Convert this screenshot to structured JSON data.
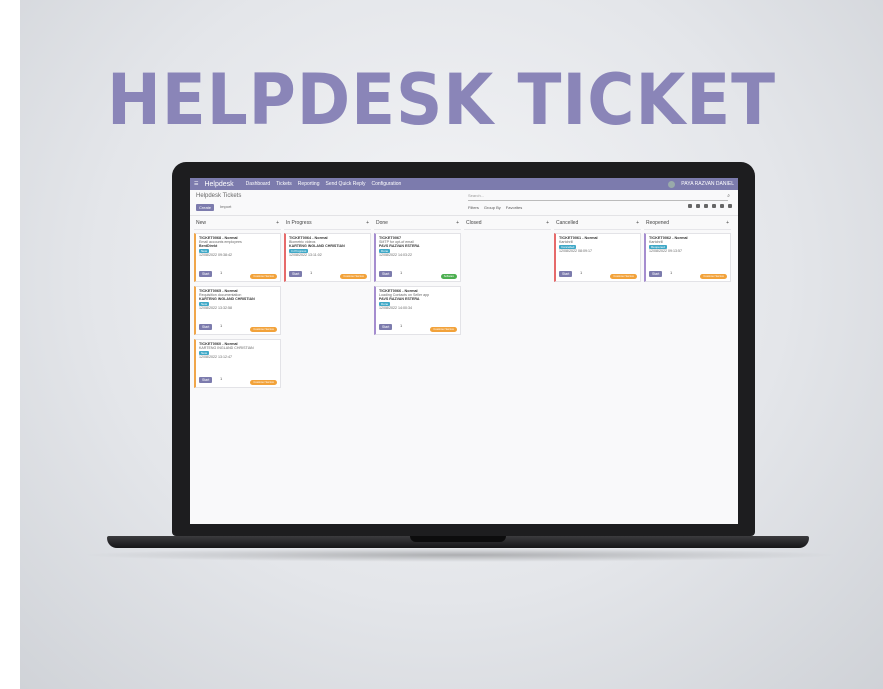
{
  "hero": {
    "title": "HELPDESK TICKET"
  },
  "app": {
    "brand": "Helpdesk",
    "menu": [
      "Dashboard",
      "Tickets",
      "Reporting",
      "Send Quick Reply",
      "Configuration"
    ],
    "user": "PAYA RAZVAN DANIEL"
  },
  "control_panel": {
    "title": "Helpdesk Tickets",
    "create_label": "Create",
    "import_label": "Import",
    "search_placeholder": "Search...",
    "filters_label": "Filters",
    "group_by_label": "Group By",
    "favorites_label": "Favorites"
  },
  "columns": [
    {
      "name": "New",
      "add": "+",
      "cards": [
        {
          "title": "TICKET0068 - Normal",
          "line1": "Email accounts employees",
          "line2": "BentDirekt",
          "tag": "New",
          "date": "12/08/2022 09:38:42",
          "start": "Start",
          "user": "1",
          "pill": "Customer Service",
          "variant": "orange"
        },
        {
          "title": "TICKET0065 - Normal",
          "line1": "Requisition documentation",
          "line2": "KARTENG INGLAND CHRISTIAN",
          "tag": "New",
          "date": "12/08/2022 13:32:58",
          "start": "Start",
          "user": "1",
          "pill": "Customer Service",
          "variant": "orange"
        },
        {
          "title": "TICKET0060 - Normal",
          "line1": "KARTENG INGLAND CHRISTIAN",
          "line2": "",
          "tag": "New",
          "date": "12/08/2022 13:12:47",
          "start": "Start",
          "user": "1",
          "pill": "Customer Service",
          "variant": "orange"
        }
      ]
    },
    {
      "name": "In Progress",
      "add": "+",
      "cards": [
        {
          "title": "TICKET0064 - Normal",
          "line1": "Biometric videos",
          "line2": "KARTENG INGLAND CHRISTIAN",
          "tag": "In Progress",
          "date": "12/08/2022 13:11:02",
          "start": "Start",
          "user": "1",
          "pill": "Customer Service",
          "variant": "red"
        }
      ]
    },
    {
      "name": "Done",
      "add": "+",
      "cards": [
        {
          "title": "TICKET0067",
          "line1": "SMTP for opt-of email",
          "line2": "PAVS RAZVAN ESTERA",
          "tag": "Done",
          "date": "12/08/2022 14:03:22",
          "start": "Start",
          "user": "1",
          "pill": "Software",
          "variant": "purple"
        },
        {
          "title": "TICKET0066 - Normal",
          "line1": "Loading Contacts on Seller app",
          "line2": "PAVS RAZVAN ESTERA",
          "tag": "Done",
          "date": "12/08/2022 14:00:34",
          "start": "Start",
          "user": "1",
          "pill": "Customer Service",
          "variant": "purple"
        }
      ]
    },
    {
      "name": "Closed",
      "add": "+",
      "cards": []
    },
    {
      "name": "Cancelled",
      "add": "+",
      "cards": [
        {
          "title": "TICKET0061 - Normal",
          "line1": "Kartchrill",
          "line2": "",
          "tag": "Cancelled",
          "date": "12/08/2022 08:09:17",
          "start": "Start",
          "user": "1",
          "pill": "Customer Service",
          "variant": "red"
        }
      ]
    },
    {
      "name": "Reopened",
      "add": "+",
      "cards": [
        {
          "title": "TICKET0062 - Normal",
          "line1": "Kartchrill",
          "line2": "",
          "tag": "Reopened",
          "date": "12/08/2022 09:13:57",
          "start": "Start",
          "user": "1",
          "pill": "Customer Service",
          "variant": "purple"
        }
      ]
    }
  ]
}
